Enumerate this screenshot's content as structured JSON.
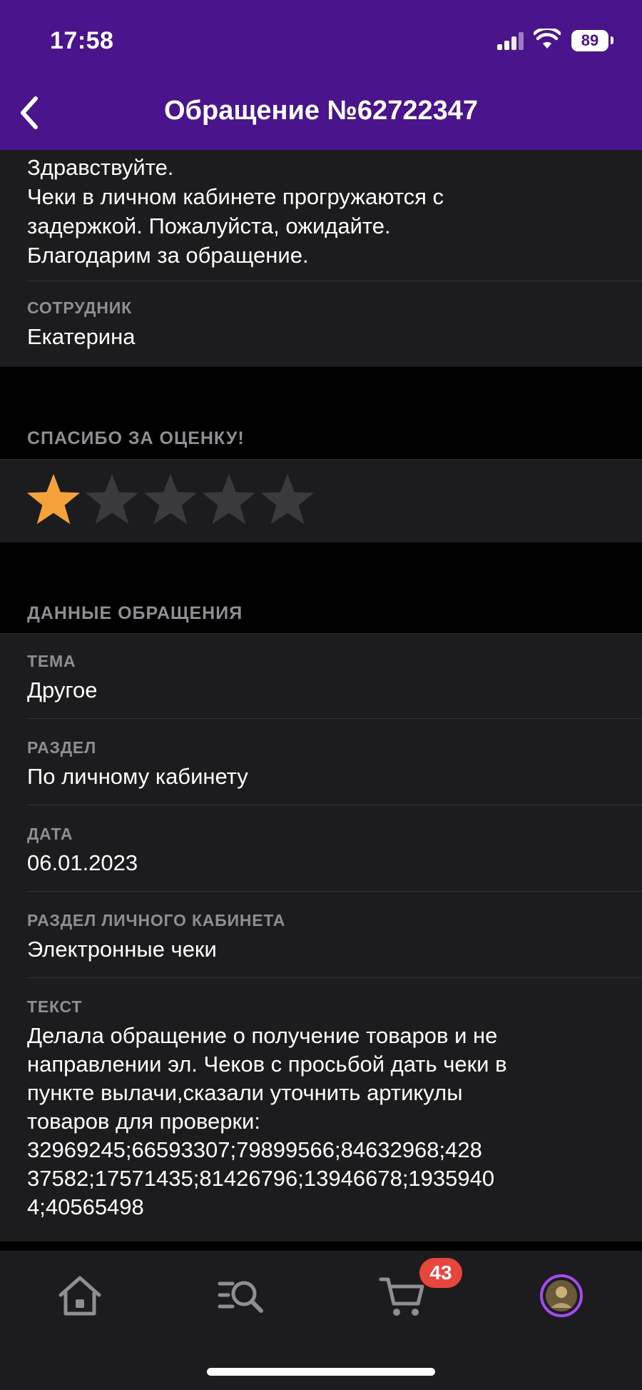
{
  "status_bar": {
    "time": "17:58",
    "battery": "89"
  },
  "header": {
    "title": "Обращение №62722347"
  },
  "reply": {
    "lines": [
      "Здравствуйте.",
      "Чеки в личном кабинете прогружаются с",
      "задержкой. Пожалуйста, ожидайте.",
      "Благодарим за обращение."
    ],
    "employee_label": "СОТРУДНИК",
    "employee_name": "Екатерина"
  },
  "rating": {
    "title": "СПАСИБО ЗА ОЦЕНКУ!",
    "value": 1,
    "max": 5,
    "active_color": "#f5a23a",
    "inactive_color": "#3a3a3c"
  },
  "details": {
    "section_title": "ДАННЫЕ ОБРАЩЕНИЯ",
    "fields": [
      {
        "label": "ТЕМА",
        "value": "Другое"
      },
      {
        "label": "РАЗДЕЛ",
        "value": "По личному кабинету"
      },
      {
        "label": "ДАТА",
        "value": "06.01.2023"
      },
      {
        "label": "РАЗДЕЛ ЛИЧНОГО КАБИНЕТА",
        "value": "Электронные чеки"
      }
    ],
    "text_label": "ТЕКСТ",
    "text_lines": [
      "Делала обращение о получение товаров и не",
      "направлении эл. Чеков с просьбой дать чеки в",
      "пункте вылачи,сказали уточнить артикулы",
      "товаров для проверки:",
      "32969245;66593307;79899566;84632968;428",
      "37582;17571435;81426796;13946678;1935940",
      "4;40565498"
    ]
  },
  "tab_bar": {
    "items": [
      {
        "name": "home",
        "icon": "home-icon"
      },
      {
        "name": "catalog-search",
        "icon": "search-list-icon"
      },
      {
        "name": "cart",
        "icon": "cart-icon",
        "badge": "43"
      },
      {
        "name": "profile",
        "icon": "avatar"
      }
    ],
    "colors": {
      "icon": "#8e8e93",
      "accent": "#a64bf4",
      "badge": "#e8453c"
    }
  }
}
